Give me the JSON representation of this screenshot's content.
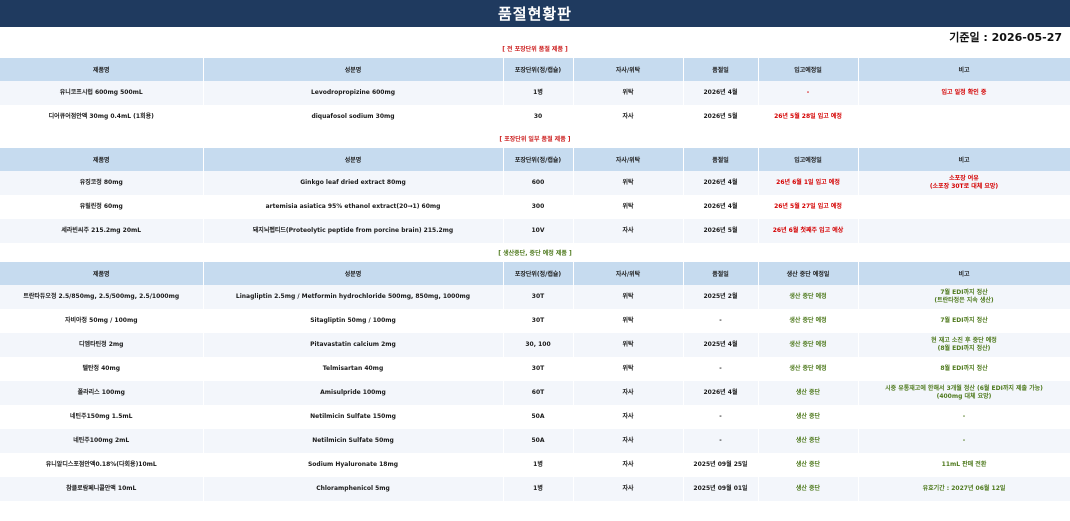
{
  "title": "품절현황판",
  "base_date": "기준일 : 2026-05-27",
  "sections": [
    {
      "title": "[ 전 포장단위 품절 제품 ]",
      "headers": [
        "제품명",
        "성분명",
        "포장단위(정/캡슐)",
        "자사/위탁",
        "품절일",
        "입고예정일",
        "비고"
      ],
      "rows": [
        [
          "유니코프시럽 600mg 500mL",
          "Levodropropizine 600mg",
          "1병",
          "위탁",
          "2026년 4월",
          "-",
          "입고 일정 확인 중"
        ],
        [
          "디어큐어점안액 30mg 0.4mL (1회용)",
          "diquafosol sodium 30mg",
          "30",
          "자사",
          "2026년 5월",
          "26년 5월 28일 입고 예정",
          ""
        ]
      ]
    },
    {
      "title": "[ 포장단위 일부 품절 제품 ]",
      "headers": [
        "제품명",
        "성분명",
        "포장단위(정/캡슐)",
        "자사/위탁",
        "품절일",
        "입고예정일",
        "비고"
      ],
      "rows": [
        [
          "유징코정 80mg",
          "Ginkgo leaf dried extract 80mg",
          "600",
          "위탁",
          "2026년 4월",
          "26년 6월 1일 입고 예정",
          "소포장 여유|(소포장 30T로 대체 요망)"
        ],
        [
          "유릴린정 60mg",
          "artemisia asiatica 95% ethanol extract(20→1) 60mg",
          "300",
          "위탁",
          "2026년 4월",
          "26년 5월 27일 입고 예정",
          ""
        ],
        [
          "세라빈씨주 215.2mg 20mL",
          "돼지뇌펩티드(Proteolytic peptide from porcine brain) 215.2mg",
          "10V",
          "자사",
          "2026년 5월",
          "26년 6월 첫째주 입고 예상",
          ""
        ]
      ]
    },
    {
      "title": "[ 생산중단, 중단 예정 제품 ]",
      "headers": [
        "제품명",
        "성분명",
        "포장단위(정/캡슐)",
        "자사/위탁",
        "품절일",
        "생산 중단 예정일",
        "비고"
      ],
      "rows": [
        [
          "트란타듀오정 2.5/850mg, 2.5/500mg, 2.5/1000mg",
          "Linagliptin 2.5mg / Metformin hydrochloride 500mg, 850mg, 1000mg",
          "30T",
          "위탁",
          "2025년 2월",
          "생산 중단 예정",
          "7월 EDI까지 정산|(트란타정은 지속 생산)"
        ],
        [
          "자비아정 50mg / 100mg",
          "Sitagliptin 50mg / 100mg",
          "30T",
          "위탁",
          "-",
          "생산 중단 예정",
          "7월 EDI까지 정산"
        ],
        [
          "디엠타틴정 2mg",
          "Pitavastatin calcium 2mg",
          "30, 100",
          "위탁",
          "2025년 4월",
          "생산 중단 예정",
          "현 재고 소진 후 중단 예정|(8월 EDI까지 정산)"
        ],
        [
          "텔탄정 40mg",
          "Telmisartan 40mg",
          "30T",
          "위탁",
          "-",
          "생산 중단 예정",
          "8월 EDI까지 정산"
        ],
        [
          "폴라리스 100mg",
          "Amisulpride 100mg",
          "60T",
          "자사",
          "2026년 4월",
          "생산 중단",
          "시중 유통재고에 한해서 3개월 정산 (6월 EDI까지 제출 가능)|(400mg 대체 요망)"
        ],
        [
          "네틴주150mg 1.5mL",
          "Netilmicin Sulfate 150mg",
          "50A",
          "자사",
          "-",
          "생산 중단",
          "-"
        ],
        [
          "네틴주100mg 2mL",
          "Netilmicin Sulfate 50mg",
          "50A",
          "자사",
          "-",
          "생산 중단",
          "-"
        ],
        [
          "유니알디스포점안액0.18%(다회용)10mL",
          "Sodium Hyaluronate 18mg",
          "1병",
          "자사",
          "2025년 09월 25일",
          "생산 중단",
          "11mL 판매 전환"
        ],
        [
          "참클로람페니콜안액 10mL",
          "Chloramphenicol 5mg",
          "1병",
          "자사",
          "2025년 09월 01일",
          "생산 중단",
          "유효기간 : 2027년 06월 12일"
        ]
      ]
    }
  ],
  "colors": {
    "title_bg": "#1f3a5f",
    "header_bg": "#c6dbef",
    "red": "#d40000",
    "green": "#4f7a1e"
  }
}
